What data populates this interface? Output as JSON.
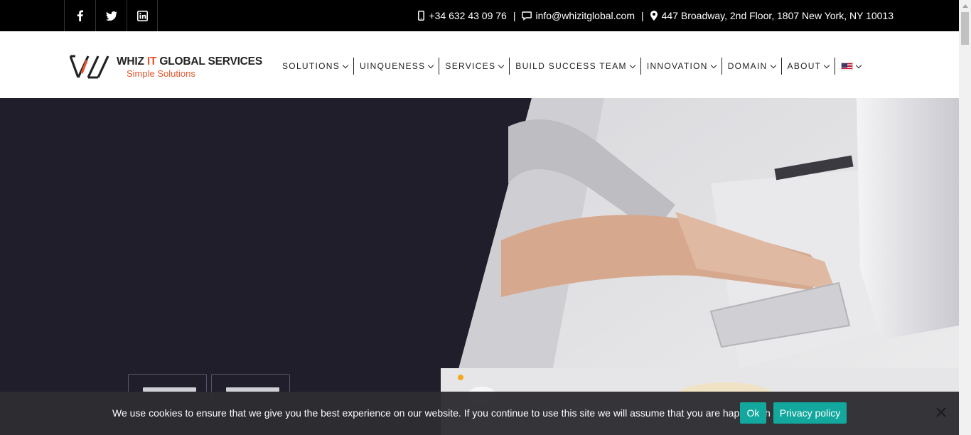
{
  "topbar": {
    "social": [
      {
        "name": "facebook-icon",
        "glyph": "f"
      },
      {
        "name": "twitter-icon",
        "glyph": "twitter"
      },
      {
        "name": "linkedin-icon",
        "glyph": "in"
      }
    ],
    "phone": "+34 632 43 09 76",
    "email": "info@whizitglobal.com",
    "address": "447 Broadway, 2nd Floor, 1807 New York, NY 10013",
    "separator": "|"
  },
  "header": {
    "logo_name_pre": "WHIZ ",
    "logo_name_it": "IT",
    "logo_name_post": " GLOBAL SERVICES",
    "logo_tagline": "Simple Solutions",
    "nav": [
      {
        "label": "SOLUTIONS"
      },
      {
        "label": "UINQUENESS"
      },
      {
        "label": "SERVICES"
      },
      {
        "label": "BUILD SUCCESS TEAM"
      },
      {
        "label": "INNOVATION"
      },
      {
        "label": "DOMAIN"
      },
      {
        "label": "ABOUT"
      }
    ],
    "language": "us-flag-icon"
  },
  "cookie": {
    "message": "We use cookies to ensure that we give you the best experience on our website. If you continue to use this site we will assume that you are happy with it.",
    "ok_label": "Ok",
    "privacy_label": "Privacy policy"
  },
  "colors": {
    "accent": "#e4572e",
    "button": "#13a89e",
    "hero_bg": "#1f1e2a",
    "topbar_bg": "#000000"
  }
}
